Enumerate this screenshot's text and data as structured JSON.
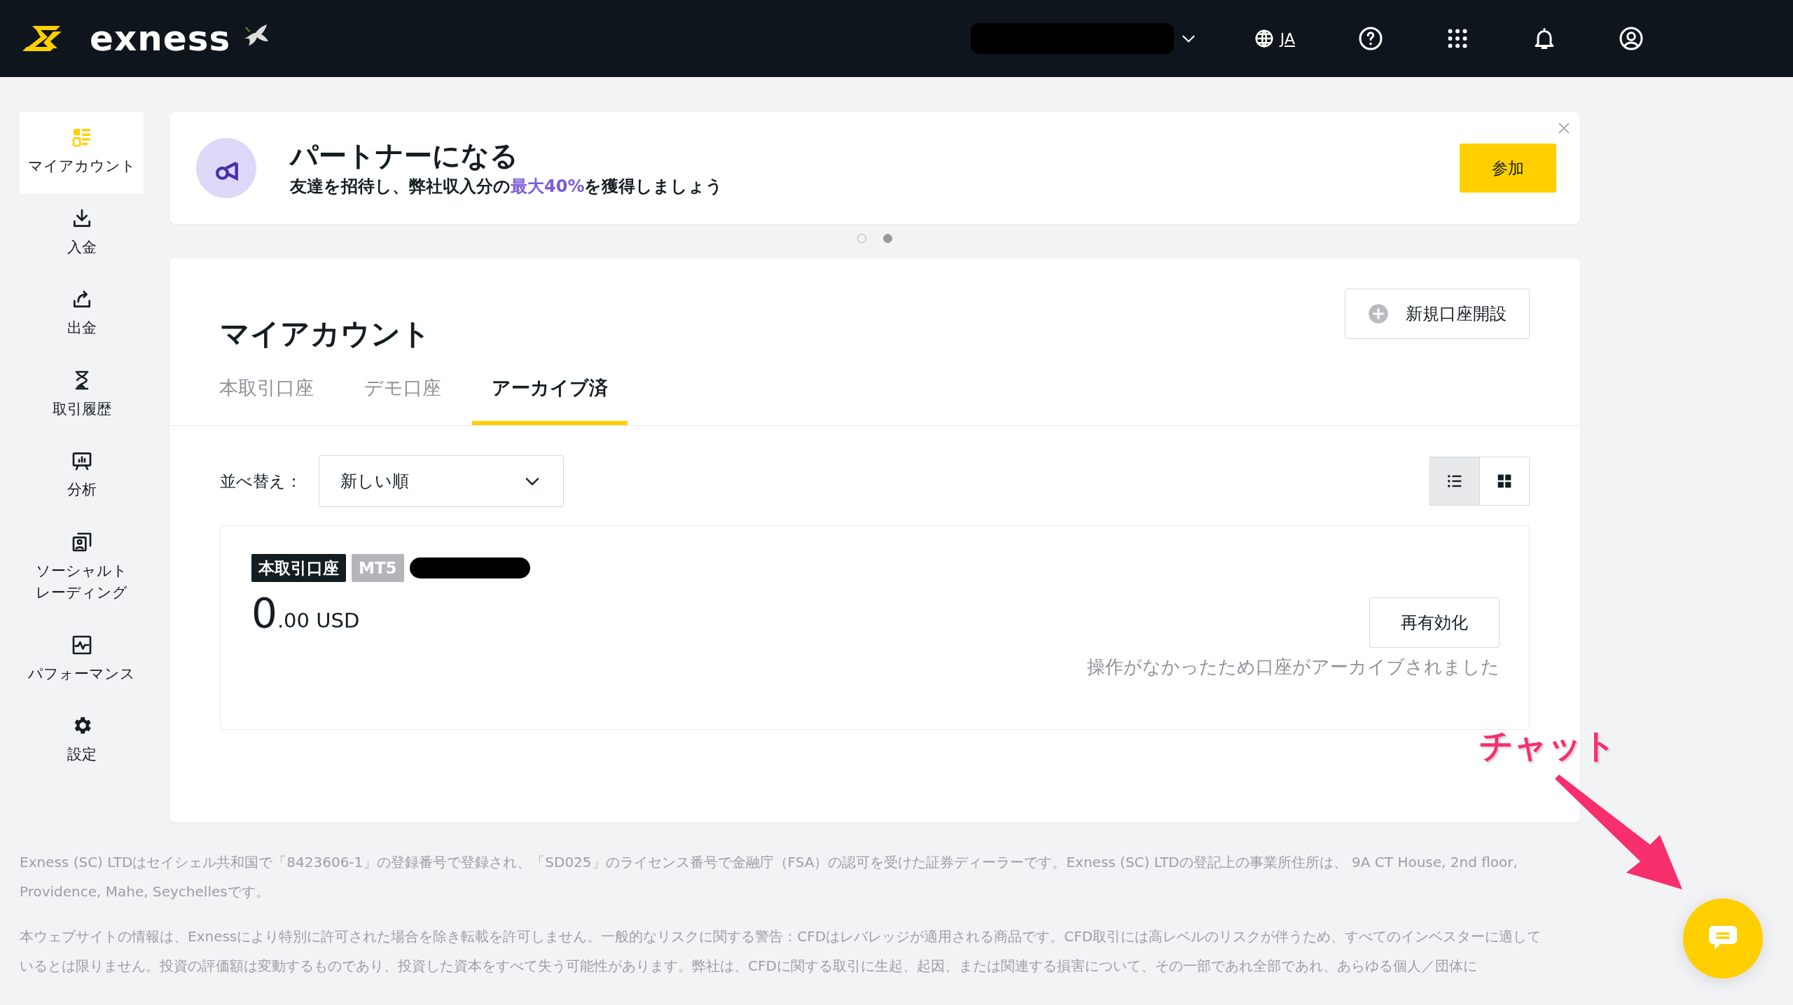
{
  "header": {
    "logo": "exness",
    "language": "JA"
  },
  "sidebar": {
    "items": [
      {
        "label": "マイアカウント",
        "kind": "dashboard",
        "selected": true
      },
      {
        "label": "入金",
        "kind": "deposit",
        "selected": false
      },
      {
        "label": "出金",
        "kind": "withdraw",
        "selected": false
      },
      {
        "label": "取引履歴",
        "kind": "history",
        "selected": false
      },
      {
        "label": "分析",
        "kind": "analytics",
        "selected": false
      },
      {
        "label": "ソーシャルトレーディング",
        "kind": "social",
        "selected": false
      },
      {
        "label": "パフォーマンス",
        "kind": "performance",
        "selected": false
      },
      {
        "label": "設定",
        "kind": "settings",
        "selected": false
      }
    ]
  },
  "banner": {
    "title": "パートナーになる",
    "subtitle_parts": [
      {
        "text": "友達を招待し、弊社収入分の",
        "highlight": false
      },
      {
        "text": "最大40%",
        "highlight": true
      },
      {
        "text": "を獲得しましょう",
        "highlight": false
      }
    ],
    "button": "参加",
    "dots": [
      {
        "selected": false
      },
      {
        "selected": true
      }
    ]
  },
  "main": {
    "title": "マイアカウント",
    "new_account_button": "新規口座開設",
    "tabs": [
      {
        "label": "本取引口座",
        "selected": false
      },
      {
        "label": "デモ口座",
        "selected": false
      },
      {
        "label": "アーカイブ済",
        "selected": true
      }
    ],
    "sort": {
      "label": "並べ替え：",
      "value": "新しい順"
    },
    "view_toggle": [
      {
        "kind": "list",
        "selected": true
      },
      {
        "kind": "grid",
        "selected": false
      }
    ],
    "account": {
      "badges": [
        {
          "text": "本取引口座",
          "kind": "type"
        },
        {
          "text": "MT5",
          "kind": "platform"
        }
      ],
      "balance_integer": "0",
      "balance_rest": ".00 USD",
      "button": "再有効化",
      "note": "操作がなかったため口座がアーカイブされました"
    }
  },
  "footer": {
    "paragraphs": [
      "Exness (SC) LTDはセイシェル共和国で「8423606-1」の登録番号で登録され、「SD025」のライセンス番号で金融庁（FSA）の認可を受けた証券ディーラーです。Exness (SC) LTDの登記上の事業所住所は、 9A CT House, 2nd floor, Providence, Mahe, Seychellesです。",
      "本ウェブサイトの情報は、Exnessにより特別に許可された場合を除き転載を許可しません。一般的なリスクに関する警告：CFDはレバレッジが適用される商品です。CFD取引には高レベルのリスクが伴うため、すべてのインベスターに適しているとは限りません。投資の評価額は変動するものであり、投資した資本をすべて失う可能性があります。弊社は、CFDに関する取引に生起、起因、または関連する損害について、その一部であれ全部であれ、あらゆる個人／団体に"
    ]
  },
  "annotation": {
    "text": "チャット"
  }
}
